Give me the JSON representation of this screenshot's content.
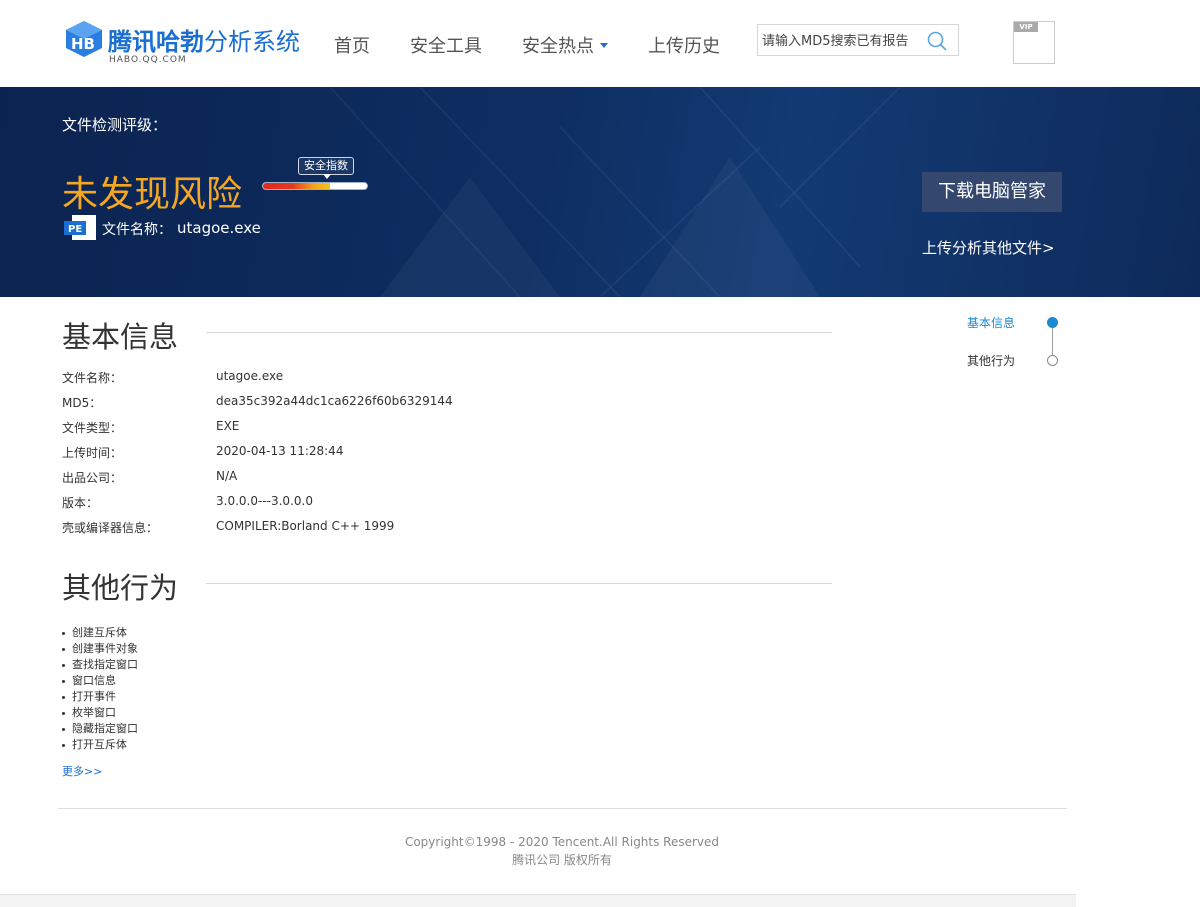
{
  "header": {
    "logo_title_bold": "腾讯哈勃",
    "logo_title_rest": "分析系统",
    "logo_sub": "HABO.QQ.COM",
    "nav": [
      {
        "label": "首页"
      },
      {
        "label": "安全工具"
      },
      {
        "label": "安全热点",
        "has_dropdown": true
      },
      {
        "label": "上传历史"
      }
    ],
    "search_placeholder": "请输入MD5搜索已有报告",
    "vip_label": "VIP"
  },
  "banner": {
    "rating_label": "文件检测评级：",
    "verdict": "未发现风险",
    "index_tag": "安全指数",
    "index_level": 0.64,
    "file_icon_label": "PE",
    "file_label": "文件名称：",
    "file_name": "utagoe.exe",
    "download_button": "下载电脑管家",
    "upload_link": "上传分析其他文件>"
  },
  "basic_info": {
    "title": "基本信息",
    "rows": [
      {
        "label": "文件名称：",
        "value": "utagoe.exe"
      },
      {
        "label": "MD5：",
        "value": "dea35c392a44dc1ca6226f60b6329144"
      },
      {
        "label": "文件类型：",
        "value": "EXE"
      },
      {
        "label": "上传时间：",
        "value": "2020-04-13 11:28:44"
      },
      {
        "label": "出品公司：",
        "value": "N/A"
      },
      {
        "label": "版本：",
        "value": "3.0.0.0---3.0.0.0"
      },
      {
        "label": "壳或编译器信息：",
        "value": "COMPILER:Borland C++ 1999"
      }
    ]
  },
  "other_behavior": {
    "title": "其他行为",
    "items": [
      "创建互斥体",
      "创建事件对象",
      "查找指定窗口",
      "窗口信息",
      "打开事件",
      "枚举窗口",
      "隐藏指定窗口",
      "打开互斥体"
    ],
    "more_link": "更多>>"
  },
  "side_nav": [
    {
      "label": "基本信息",
      "active": true
    },
    {
      "label": "其他行为",
      "active": false
    }
  ],
  "footer": {
    "copyright": "Copyright©1998 - 2020 Tencent.All Rights Reserved",
    "copyright_cn": "腾讯公司 版权所有"
  },
  "colors": {
    "brand": "#1a6fd0",
    "verdict": "#f5a623",
    "banner_bg": "#0e2e62",
    "side_active": "#1a8ad4"
  }
}
